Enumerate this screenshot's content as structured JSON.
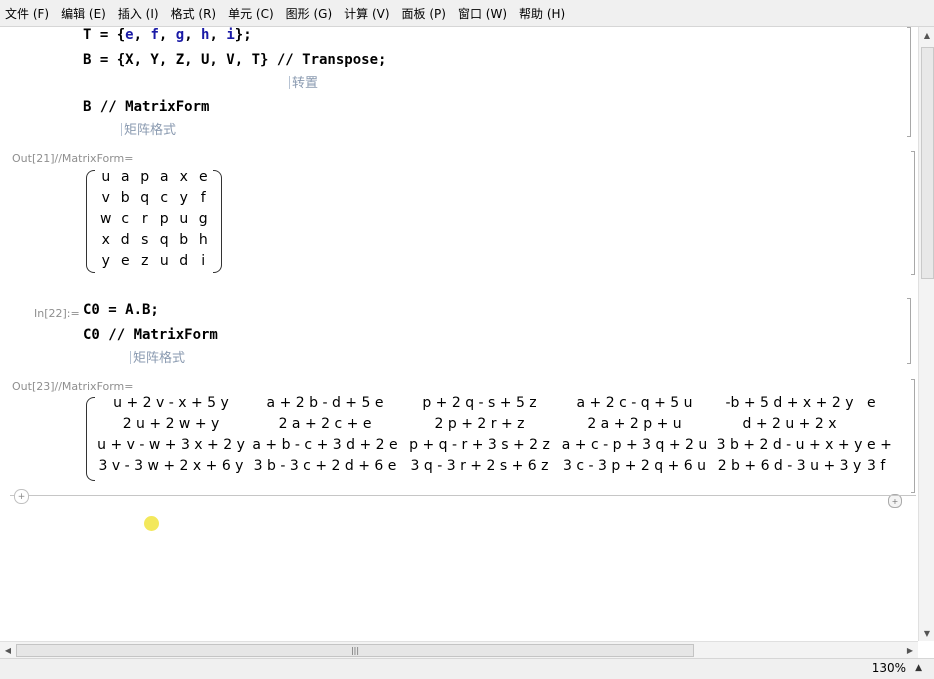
{
  "menu": [
    "文件 (F)",
    "编辑 (E)",
    "插入 (I)",
    "格式 (R)",
    "单元 (C)",
    "图形 (G)",
    "计算 (V)",
    "面板 (P)",
    "窗口 (W)",
    "帮助 (H)"
  ],
  "cells": {
    "t_line": {
      "prefix": "T = {",
      "vars": [
        "e",
        "f",
        "g",
        "h",
        "i"
      ],
      "suffix": "};"
    },
    "b_line": "B = {X, Y, Z, U, V, T} // Transpose;",
    "b_hint": "转置",
    "bmf_line": "B // MatrixForm",
    "bmf_hint": "矩阵格式",
    "out21_label": "Out[21]//MatrixForm=",
    "out21_matrix": [
      [
        "u",
        "a",
        "p",
        "a",
        "x",
        "e"
      ],
      [
        "v",
        "b",
        "q",
        "c",
        "y",
        "f"
      ],
      [
        "w",
        "c",
        "r",
        "p",
        "u",
        "g"
      ],
      [
        "x",
        "d",
        "s",
        "q",
        "b",
        "h"
      ],
      [
        "y",
        "e",
        "z",
        "u",
        "d",
        "i"
      ]
    ],
    "in22_label": "In[22]:=",
    "c0_line": "C0 = A.B;",
    "c0mf_line": "C0 // MatrixForm",
    "c0mf_hint": "矩阵格式",
    "out23_label": "Out[23]//MatrixForm=",
    "out23_matrix": [
      [
        "u + 2 v - x + 5 y",
        "a + 2 b - d + 5 e",
        "p + 2 q - s + 5 z",
        "a + 2 c - q + 5 u",
        "-b + 5 d + x + 2 y",
        "e"
      ],
      [
        "2 u + 2 w + y",
        "2 a + 2 c + e",
        "2 p + 2 r + z",
        "2 a + 2 p + u",
        "d + 2 u + 2 x",
        ""
      ],
      [
        "u + v - w + 3 x + 2 y",
        "a + b - c + 3 d + 2 e",
        "p + q - r + 3 s + 2 z",
        "a + c - p + 3 q + 2 u",
        "3 b + 2 d - u + x + y",
        "e +"
      ],
      [
        "3 v - 3 w + 2 x + 6 y",
        "3 b - 3 c + 2 d + 6 e",
        "3 q - 3 r + 2 s + 6 z",
        "3 c - 3 p + 2 q + 6 u",
        "2 b + 6 d - 3 u + 3 y",
        "3 f"
      ]
    ]
  },
  "status": {
    "zoom": "130%"
  }
}
